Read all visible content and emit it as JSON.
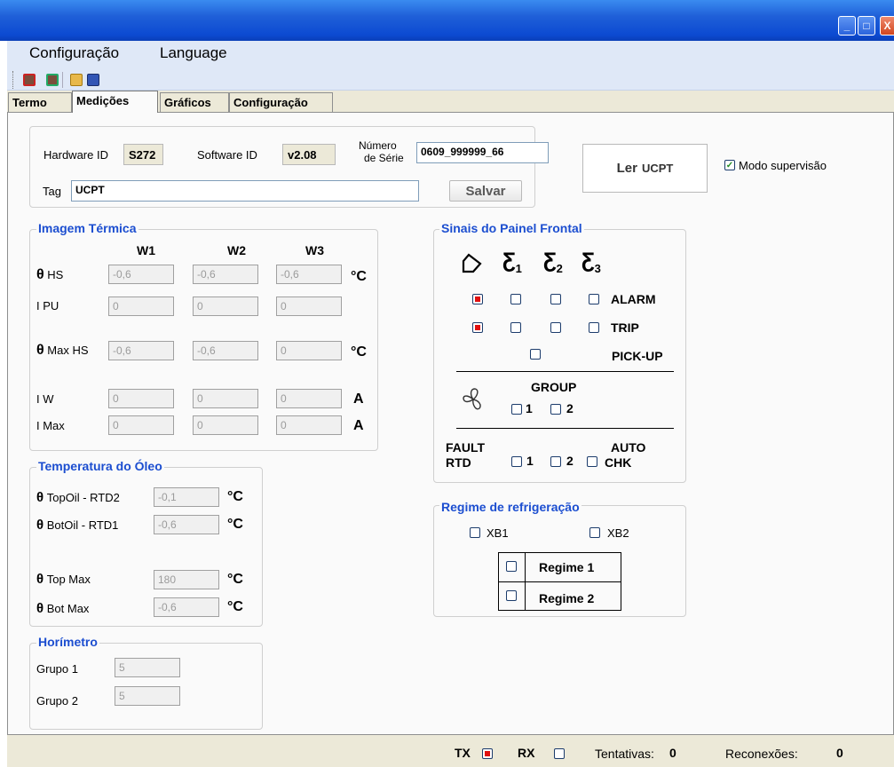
{
  "window": {
    "min": "_",
    "max": "□",
    "close": "X"
  },
  "menu": {
    "config": "Configuração",
    "language": "Language"
  },
  "toolbar": {
    "icons": [
      "device-connect-icon",
      "device-disconnect-icon",
      "open-folder-icon",
      "save-disk-icon"
    ]
  },
  "tabs": [
    "Termo",
    "Medições",
    "Gráficos",
    "Configuração"
  ],
  "top": {
    "hardware_label": "Hardware ID",
    "hardware_value": "S272",
    "software_label": "Software ID",
    "software_value": "v2.08",
    "serial_label_1": "Número",
    "serial_label_2": "de Série",
    "serial_value": "0609_999999_66",
    "tag_label": "Tag",
    "tag_value": "UCPT",
    "save_button": "Salvar",
    "read_button_1": "Ler",
    "read_button_2": "UCPT",
    "supervision_label": "Modo supervisão",
    "supervision_checked": true
  },
  "thermal": {
    "title": "Imagem Térmica",
    "cols": [
      "W1",
      "W2",
      "W3"
    ],
    "theta": "θ",
    "rows": [
      {
        "label": "HS",
        "values": [
          "-0,6",
          "-0,6",
          "-0,6"
        ],
        "unit": "°C"
      },
      {
        "label": "I PU",
        "values": [
          "0",
          "0",
          "0"
        ],
        "unit": ""
      },
      {
        "label": "Max HS",
        "values": [
          "-0,6",
          "-0,6",
          "0"
        ],
        "unit": "°C"
      },
      {
        "label": "I W",
        "values": [
          "0",
          "0",
          "0"
        ],
        "unit": "A"
      },
      {
        "label": "I Max",
        "values": [
          "0",
          "0",
          "0"
        ],
        "unit": "A"
      }
    ]
  },
  "oil": {
    "title": "Temperatura do Óleo",
    "rows": [
      {
        "label": "TopOil - RTD2",
        "value": "-0,1",
        "unit": "°C"
      },
      {
        "label": "BotOil - RTD1",
        "value": "-0,6",
        "unit": "°C"
      },
      {
        "label": "Top Max",
        "value": "180",
        "unit": "°C"
      },
      {
        "label": "Bot Max",
        "value": "-0,6",
        "unit": "°C"
      }
    ]
  },
  "hours": {
    "title": "Horímetro",
    "rows": [
      {
        "label": "Grupo 1",
        "value": "5"
      },
      {
        "label": "Grupo 2",
        "value": "5"
      }
    ]
  },
  "panel": {
    "title": "Sinais do Painel Frontal",
    "winding_subs": [
      "1",
      "2",
      "3"
    ],
    "alarm": "ALARM",
    "trip": "TRIP",
    "pickup": "PICK-UP",
    "group": "GROUP",
    "g1": "1",
    "g2": "2",
    "fault_1": "FAULT",
    "fault_2": "RTD",
    "f1": "1",
    "f2": "2",
    "auto_1": "AUTO",
    "auto_2": "CHK"
  },
  "cooling": {
    "title": "Regime de refrigeração",
    "xb1": "XB1",
    "xb2": "XB2",
    "regime1": "Regime 1",
    "regime2": "Regime 2"
  },
  "status": {
    "tx": "TX",
    "rx": "RX",
    "attempts_label": "Tentativas:",
    "attempts_value": "0",
    "reconnect_label": "Reconexões:",
    "reconnect_value": "0"
  }
}
